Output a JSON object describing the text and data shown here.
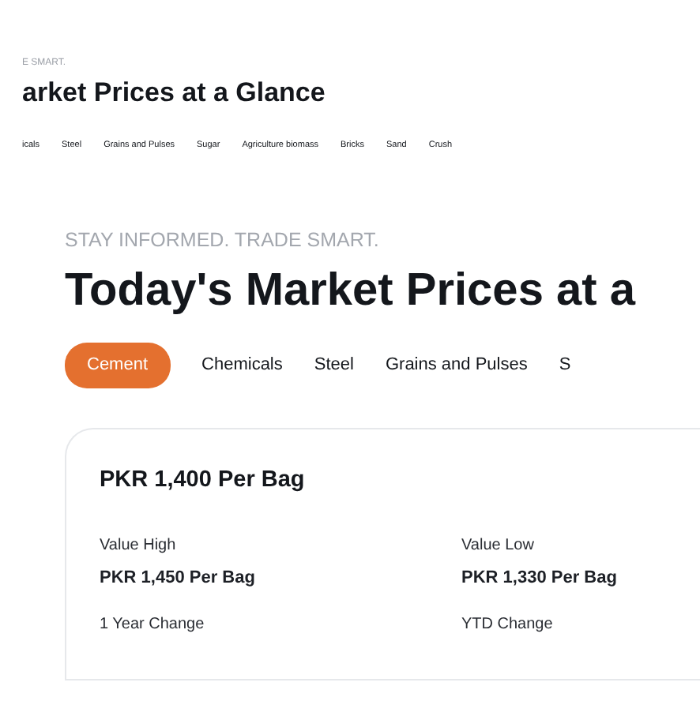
{
  "preview": {
    "tagline": "E SMART.",
    "title": "arket Prices at a Glance",
    "tabs": [
      "icals",
      "Steel",
      "Grains and Pulses",
      "Sugar",
      "Agriculture biomass",
      "Bricks",
      "Sand",
      "Crush"
    ]
  },
  "main": {
    "tagline": "STAY INFORMED. TRADE SMART.",
    "title": "Today's Market Prices at a",
    "tabs": [
      {
        "label": "Cement",
        "selected": true
      },
      {
        "label": "Chemicals",
        "selected": false
      },
      {
        "label": "Steel",
        "selected": false
      },
      {
        "label": "Grains and Pulses",
        "selected": false
      },
      {
        "label": "S",
        "selected": false
      }
    ]
  },
  "card": {
    "price": "PKR 1,400 Per Bag",
    "stats": [
      {
        "label": "Value High",
        "value": "PKR 1,450 Per Bag"
      },
      {
        "label": "Value Low",
        "value": "PKR 1,330 Per Bag"
      },
      {
        "label": "1 Year Change"
      },
      {
        "label": "YTD Change"
      }
    ]
  }
}
